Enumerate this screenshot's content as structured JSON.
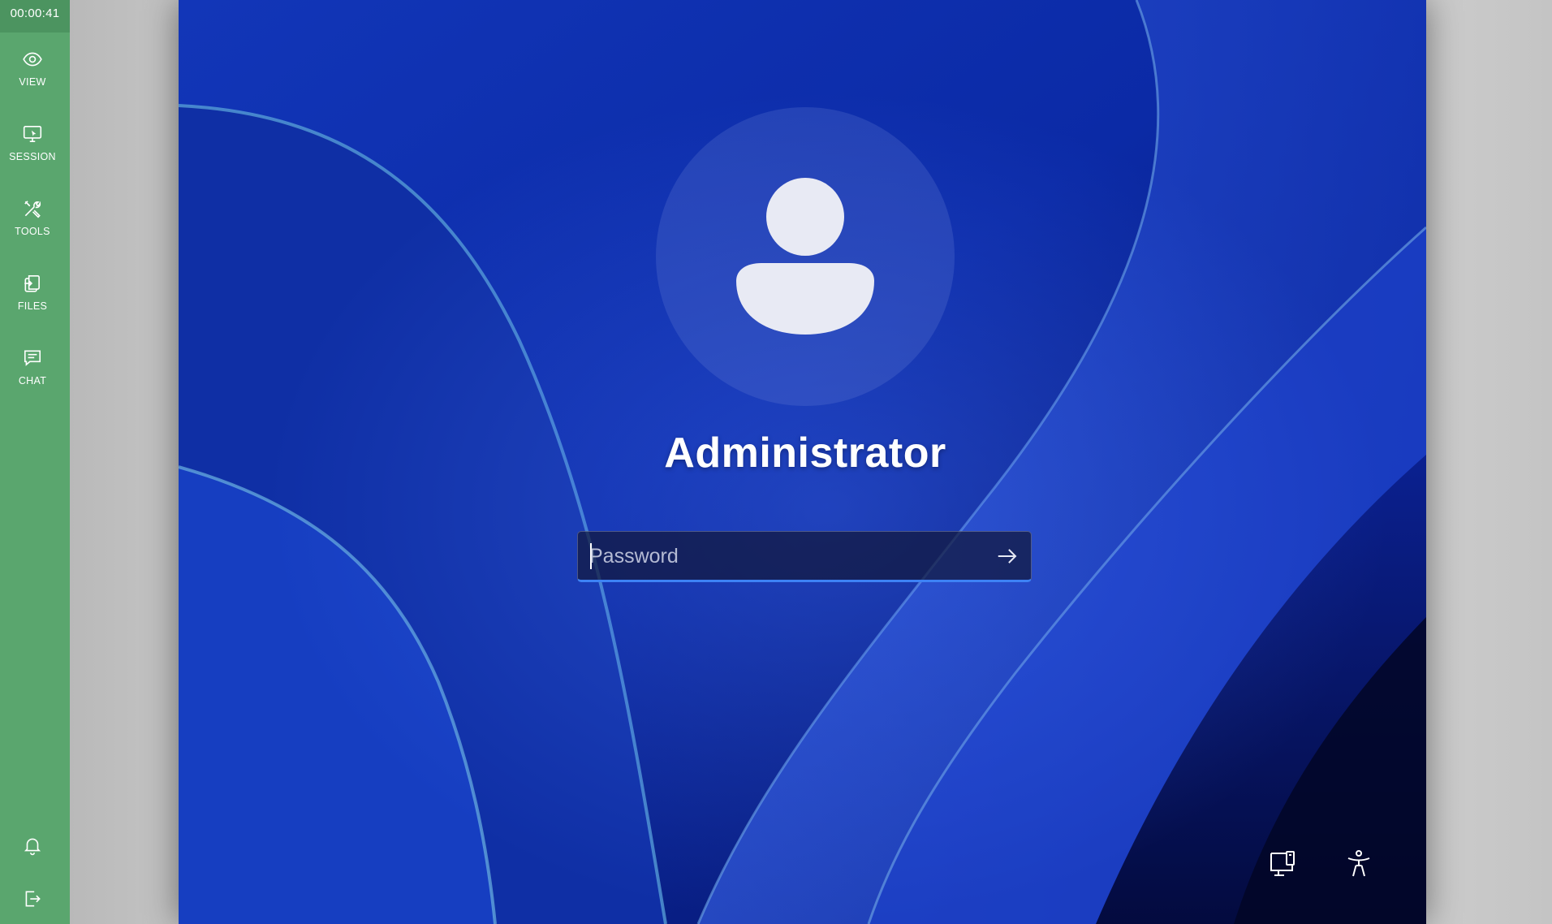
{
  "toolbar": {
    "timer": "00:00:41",
    "items": [
      {
        "id": "view",
        "label": "VIEW",
        "icon": "eye-icon"
      },
      {
        "id": "session",
        "label": "SESSION",
        "icon": "monitor-icon"
      },
      {
        "id": "tools",
        "label": "TOOLS",
        "icon": "tools-icon"
      },
      {
        "id": "files",
        "label": "FILES",
        "icon": "files-icon"
      },
      {
        "id": "chat",
        "label": "CHAT",
        "icon": "chat-icon"
      }
    ],
    "bottom": [
      {
        "id": "notifications",
        "icon": "bell-icon"
      },
      {
        "id": "exit",
        "icon": "exit-icon"
      }
    ],
    "color": "#5aa66e"
  },
  "login": {
    "user_name": "Administrator",
    "password_placeholder": "Password",
    "password_value": "",
    "submit_icon": "arrow-right-icon",
    "accent_color": "#3d82f5",
    "corner_buttons": [
      {
        "id": "network",
        "icon": "network-icon"
      },
      {
        "id": "accessibility",
        "icon": "accessibility-icon"
      }
    ]
  }
}
